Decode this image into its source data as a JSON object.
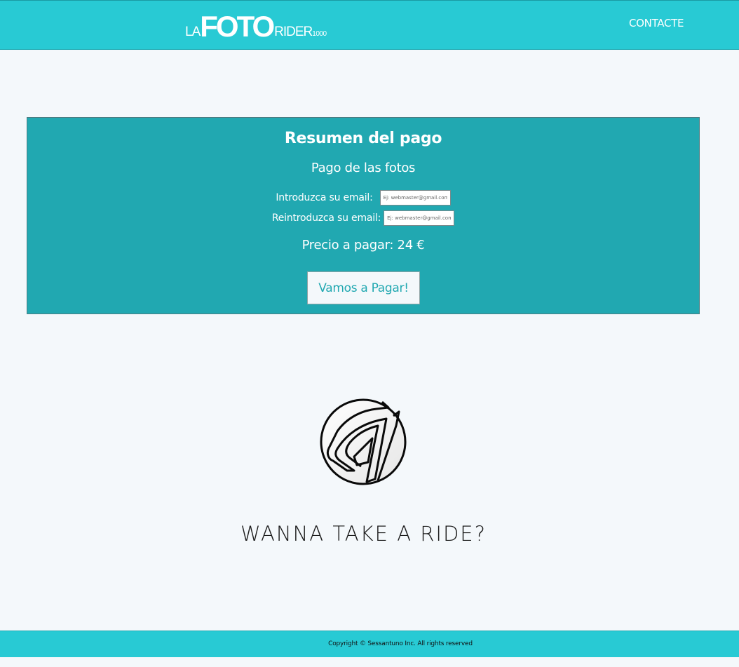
{
  "header": {
    "logo": {
      "la": "LA",
      "foto": "FOTO",
      "rider": "RIDER",
      "number": "1000"
    },
    "nav": {
      "contact_label": "CONTACTE"
    }
  },
  "summary": {
    "title": "Resumen del pago",
    "subtitle": "Pago de las fotos",
    "email_label": "Introduzca su email:",
    "email_placeholder": "Ej: webmaster@gmail.com",
    "email_confirm_label": "Reintroduzca su email:",
    "email_confirm_placeholder": "Ej: webmaster@gmail.com",
    "price_text": "Precio a pagar: 24 €",
    "pay_button_label": "Vamos a Pagar!"
  },
  "hero": {
    "icon": "ride-logo-icon",
    "tagline": "WANNA TAKE A RIDE?"
  },
  "footer": {
    "copyright": "Copyright © Sessantuno Inc. All rights reserved"
  },
  "colors": {
    "header_bg": "#28cad4",
    "panel_bg": "#21a8b1",
    "page_bg": "#f4f8fb",
    "button_text": "#21a8b1"
  }
}
